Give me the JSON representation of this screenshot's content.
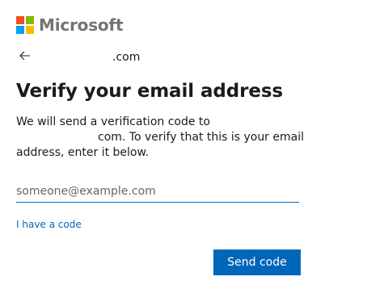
{
  "brand": {
    "name": "Microsoft",
    "logo_colors": [
      "#f25022",
      "#7fba00",
      "#00a4ef",
      "#ffb900"
    ]
  },
  "identity": {
    "back_icon": "arrow-left-icon",
    "account": ".com"
  },
  "heading": "Verify your email address",
  "description": {
    "line1": "We will send a verification code to",
    "line2": "com. To verify that this is your email",
    "line3": "address, enter it below."
  },
  "email_input": {
    "placeholder": "someone@example.com",
    "value": ""
  },
  "links": {
    "have_code": "I have a code"
  },
  "buttons": {
    "send_code": "Send code"
  },
  "colors": {
    "accent": "#0067b8",
    "text": "#1b1b1b",
    "logo_text": "#737373"
  }
}
